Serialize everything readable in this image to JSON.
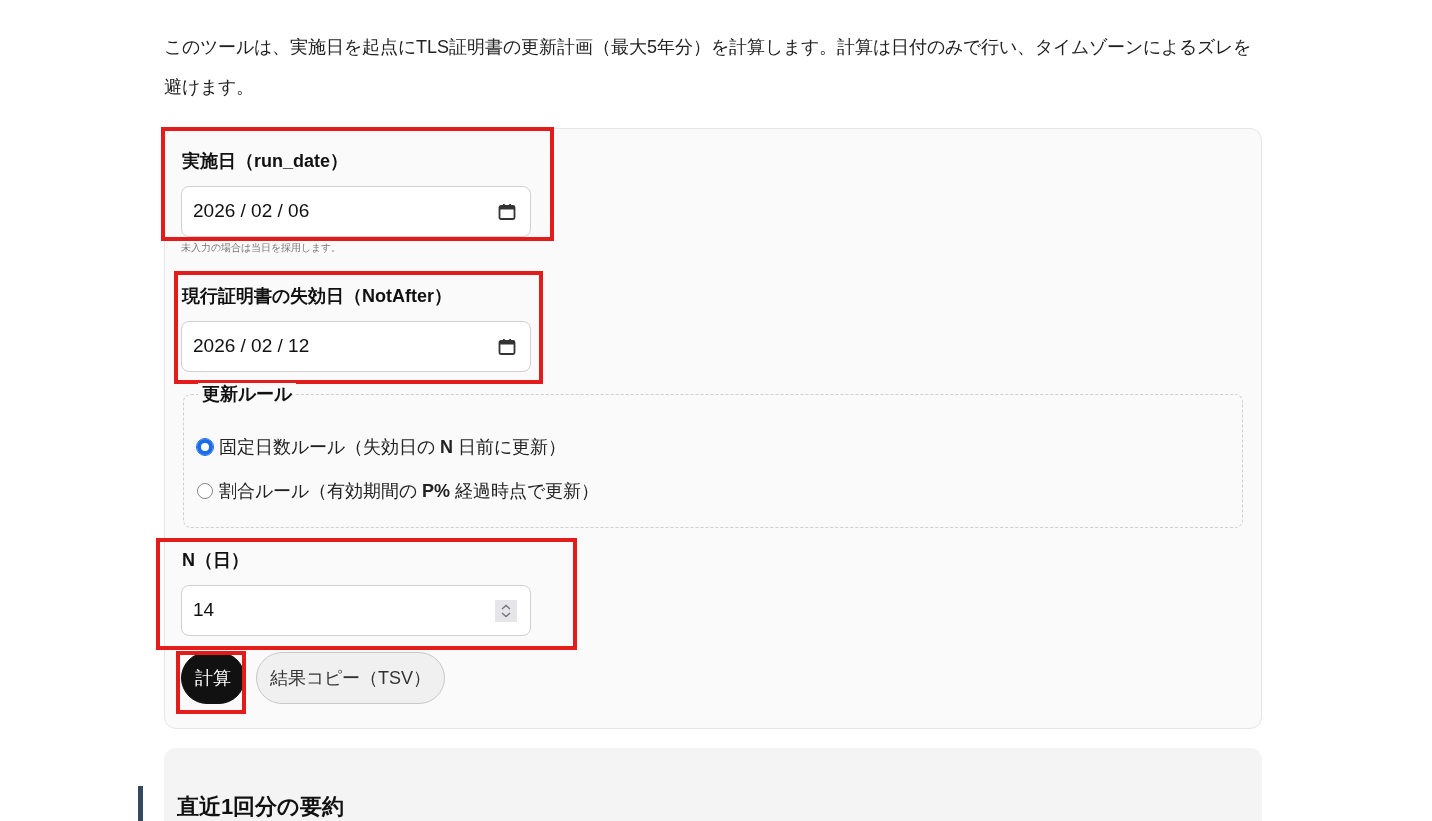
{
  "intro": "このツールは、実施日を起点にTLS証明書の更新計画（最大5年分）を計算します。計算は日付のみで行い、タイムゾーンによるズレを避けます。",
  "form": {
    "items": [
      {
        "kind": "date",
        "label": "実施日（run_date）",
        "value": "2026 / 02 / 06",
        "hint": "未入力の場合は当日を採用します。",
        "highlighted": true
      },
      {
        "kind": "date",
        "label": "現行証明書の失効日（NotAfter）",
        "value": "2026 / 02 / 12",
        "highlighted": true
      },
      {
        "kind": "radio_group",
        "legend": "更新ルール",
        "options": [
          {
            "label": "固定日数ルール（失効日の **N** 日前に更新）",
            "selected": true
          },
          {
            "label": "割合ルール（有効期間の **P%** 経過時点で更新）",
            "selected": false
          }
        ]
      },
      {
        "kind": "number",
        "label": "N（日）",
        "value": "14",
        "highlighted": true
      }
    ],
    "buttons": [
      {
        "kind": "primary",
        "label": "計算",
        "highlighted": true
      },
      {
        "kind": "secondary",
        "label": "結果コピー（TSV）",
        "highlighted": false
      }
    ]
  },
  "summary": {
    "heading": "直近1回分の要約"
  }
}
